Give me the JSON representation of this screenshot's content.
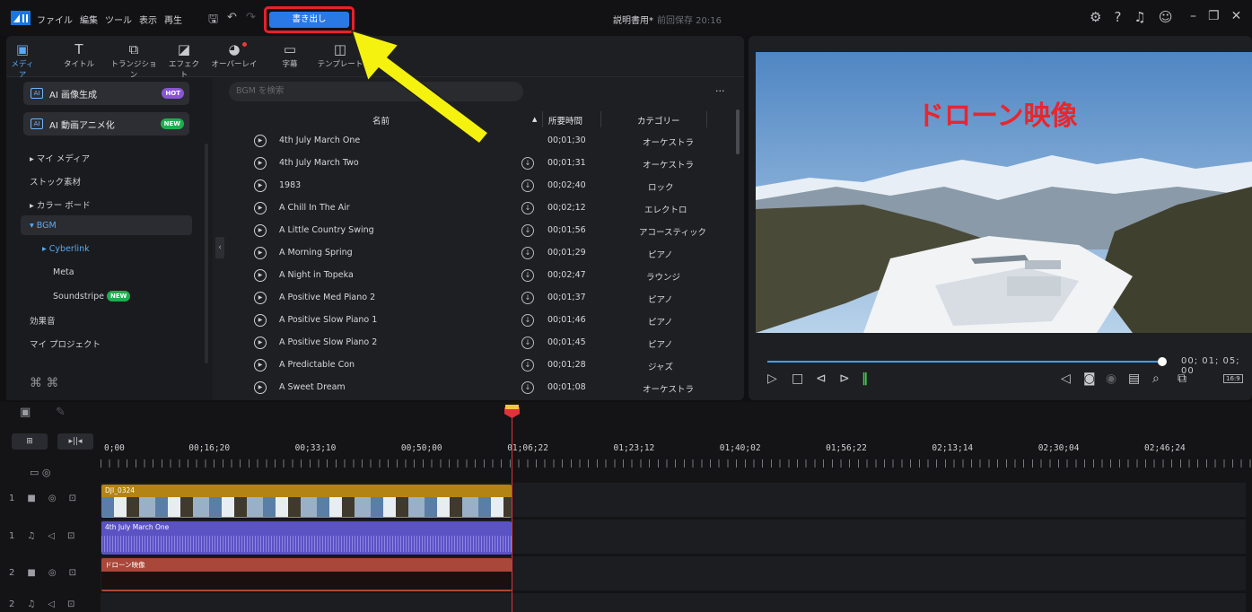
{
  "menubar": {
    "menus": [
      "ファイル",
      "編集",
      "ツール",
      "表示",
      "再生"
    ],
    "export_label": "書き出し",
    "title": "説明書用*",
    "autosave": "前回保存 20:16"
  },
  "tabs": [
    {
      "label": "メディア",
      "icon": "media-icon",
      "glyph": "▣"
    },
    {
      "label": "タイトル",
      "icon": "title-icon",
      "glyph": "T"
    },
    {
      "label": "トランジション",
      "icon": "transition-icon",
      "glyph": "⧉"
    },
    {
      "label": "エフェクト",
      "icon": "effect-icon",
      "glyph": "◪"
    },
    {
      "label": "オーバーレイ",
      "icon": "overlay-icon",
      "glyph": "◕"
    },
    {
      "label": "字幕",
      "icon": "subtitle-icon",
      "glyph": "▭"
    },
    {
      "label": "テンプレート",
      "icon": "template-icon",
      "glyph": "◫"
    }
  ],
  "sidebar": {
    "ai_image": {
      "label": "AI 画像生成",
      "badge": "HOT"
    },
    "ai_anime": {
      "label": "AI 動画アニメ化",
      "badge": "NEW"
    },
    "items": [
      {
        "label": "▸ マイ メディア"
      },
      {
        "label": "ストック素材"
      },
      {
        "label": "▸ カラー ボード"
      },
      {
        "label": "▾ BGM"
      },
      {
        "label": "▸ Cyberlink"
      },
      {
        "label": "Meta"
      },
      {
        "label": "Soundstripe",
        "badge": "NEW"
      },
      {
        "label": "効果音"
      },
      {
        "label": "マイ プロジェクト"
      }
    ]
  },
  "library": {
    "search_placeholder": "BGM を検索",
    "columns": {
      "name": "名前",
      "duration": "所要時間",
      "category": "カテゴリー"
    },
    "rows": [
      {
        "name": "4th July March One",
        "duration": "00;01;30",
        "category": "オーケストラ",
        "download": false
      },
      {
        "name": "4th July March Two",
        "duration": "00;01;31",
        "category": "オーケストラ",
        "download": true
      },
      {
        "name": "1983",
        "duration": "00;02;40",
        "category": "ロック",
        "download": true
      },
      {
        "name": "A Chill In The Air",
        "duration": "00;02;12",
        "category": "エレクトロ",
        "download": true
      },
      {
        "name": "A Little Country Swing",
        "duration": "00;01;56",
        "category": "アコースティック",
        "download": true
      },
      {
        "name": "A Morning Spring",
        "duration": "00;01;29",
        "category": "ピアノ",
        "download": true
      },
      {
        "name": "A Night in Topeka",
        "duration": "00;02;47",
        "category": "ラウンジ",
        "download": true
      },
      {
        "name": "A Positive Med Piano 2",
        "duration": "00;01;37",
        "category": "ピアノ",
        "download": true
      },
      {
        "name": "A Positive Slow Piano 1",
        "duration": "00;01;46",
        "category": "ピアノ",
        "download": true
      },
      {
        "name": "A Positive Slow Piano 2",
        "duration": "00;01;45",
        "category": "ピアノ",
        "download": true
      },
      {
        "name": "A Predictable Con",
        "duration": "00;01;28",
        "category": "ジャズ",
        "download": true
      },
      {
        "name": "A Sweet Dream",
        "duration": "00;01;08",
        "category": "オーケストラ",
        "download": true
      }
    ]
  },
  "preview": {
    "overlay_title": "ドローン映像",
    "timecode": "00; 01; 05; 00",
    "ratio": "16:9",
    "progress": 0.99
  },
  "timeline": {
    "ruler": [
      "0;00",
      "00;16;20",
      "00;33;10",
      "00;50;00",
      "01;06;22",
      "01;23;12",
      "01;40;02",
      "01;56;22",
      "02;13;14",
      "02;30;04",
      "02;46;24"
    ],
    "tracks": [
      {
        "num": "1",
        "kind": "video",
        "clip": "DJI_0324"
      },
      {
        "num": "1",
        "kind": "audio",
        "clip": "4th July March One"
      },
      {
        "num": "2",
        "kind": "video",
        "clip": "ドローン映像"
      },
      {
        "num": "2",
        "kind": "audio",
        "clip": ""
      }
    ]
  },
  "colors": {
    "accent": "#2a78e4",
    "highlight": "#e8202a",
    "arrow": "#f5f20f"
  }
}
